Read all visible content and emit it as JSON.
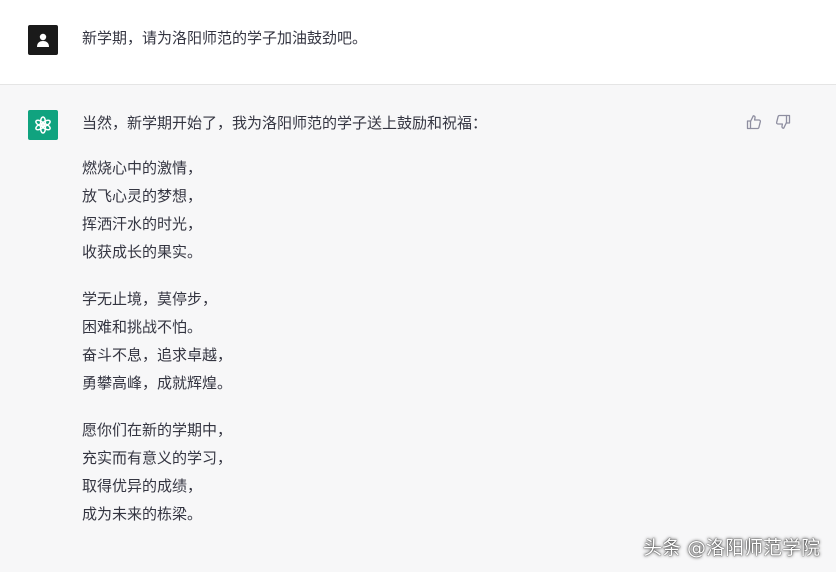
{
  "user_message": {
    "avatar_icon": "user-silhouette-icon",
    "text": "新学期，请为洛阳师范的学子加油鼓劲吧。"
  },
  "assistant_message": {
    "avatar_icon": "openai-logo-icon",
    "avatar_color": "#10a37f",
    "intro": "当然，新学期开始了，我为洛阳师范的学子送上鼓励和祝福：",
    "stanzas": [
      [
        "燃烧心中的激情，",
        "放飞心灵的梦想，",
        "挥洒汗水的时光，",
        "收获成长的果实。"
      ],
      [
        "学无止境，莫停步，",
        "困难和挑战不怕。",
        "奋斗不息，追求卓越，",
        "勇攀高峰，成就辉煌。"
      ],
      [
        "愿你们在新的学期中，",
        "充实而有意义的学习，",
        "取得优异的成绩，",
        "成为未来的栋梁。"
      ]
    ],
    "feedback": {
      "thumbs_up_icon": "thumbs-up-icon",
      "thumbs_down_icon": "thumbs-down-icon"
    }
  },
  "watermark": "头条 @洛阳师范学院"
}
